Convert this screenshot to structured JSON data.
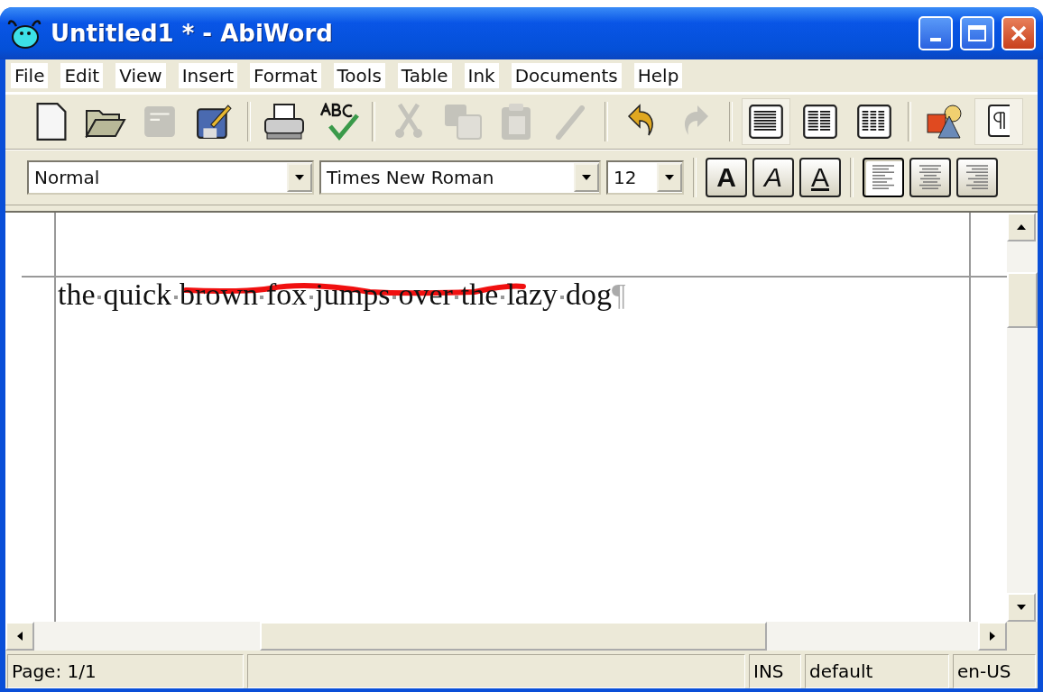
{
  "window": {
    "title": "Untitled1 * - AbiWord"
  },
  "menu": [
    "File",
    "Edit",
    "View",
    "Insert",
    "Format",
    "Tools",
    "Table",
    "Ink",
    "Documents",
    "Help"
  ],
  "standard_toolbar": [
    {
      "kind": "new",
      "disabled": false,
      "selected": false
    },
    {
      "kind": "open",
      "disabled": false,
      "selected": false
    },
    {
      "kind": "save",
      "disabled": true,
      "selected": false
    },
    {
      "kind": "save-as",
      "disabled": false,
      "selected": false
    },
    {
      "kind": "sep"
    },
    {
      "kind": "print",
      "disabled": false,
      "selected": false
    },
    {
      "kind": "spell",
      "disabled": false,
      "selected": false
    },
    {
      "kind": "sep"
    },
    {
      "kind": "cut",
      "disabled": true,
      "selected": false
    },
    {
      "kind": "copy",
      "disabled": true,
      "selected": false
    },
    {
      "kind": "paste",
      "disabled": true,
      "selected": false
    },
    {
      "kind": "brush",
      "disabled": true,
      "selected": false
    },
    {
      "kind": "sep"
    },
    {
      "kind": "undo",
      "disabled": false,
      "selected": false
    },
    {
      "kind": "redo",
      "disabled": true,
      "selected": false
    },
    {
      "kind": "sep"
    },
    {
      "kind": "layout1",
      "disabled": false,
      "selected": true
    },
    {
      "kind": "layout2",
      "disabled": false,
      "selected": false
    },
    {
      "kind": "layout3",
      "disabled": false,
      "selected": false
    },
    {
      "kind": "sep"
    },
    {
      "kind": "shapes",
      "disabled": false,
      "selected": false
    },
    {
      "kind": "pilcrow",
      "disabled": false,
      "selected": true
    }
  ],
  "format_toolbar": {
    "style": "Normal",
    "font": "Times New Roman",
    "size": "12",
    "buttons": [
      {
        "kind": "bold",
        "label": "A",
        "selected": false
      },
      {
        "kind": "italic",
        "label": "A",
        "selected": false
      },
      {
        "kind": "underline",
        "label": "A",
        "selected": false
      },
      {
        "kind": "sep"
      },
      {
        "kind": "align-left",
        "selected": true
      },
      {
        "kind": "align-center",
        "selected": false
      },
      {
        "kind": "align-right",
        "selected": false
      }
    ]
  },
  "document": {
    "words": [
      "the",
      "quick",
      "brown",
      "fox",
      "jumps",
      "over",
      "the",
      "lazy",
      "dog"
    ],
    "pilcrow": "¶",
    "show_marks": true,
    "ink_stroke": true
  },
  "status_bar": {
    "page": "Page: 1/1",
    "mode": "INS",
    "style": "default",
    "language": "en-US"
  }
}
